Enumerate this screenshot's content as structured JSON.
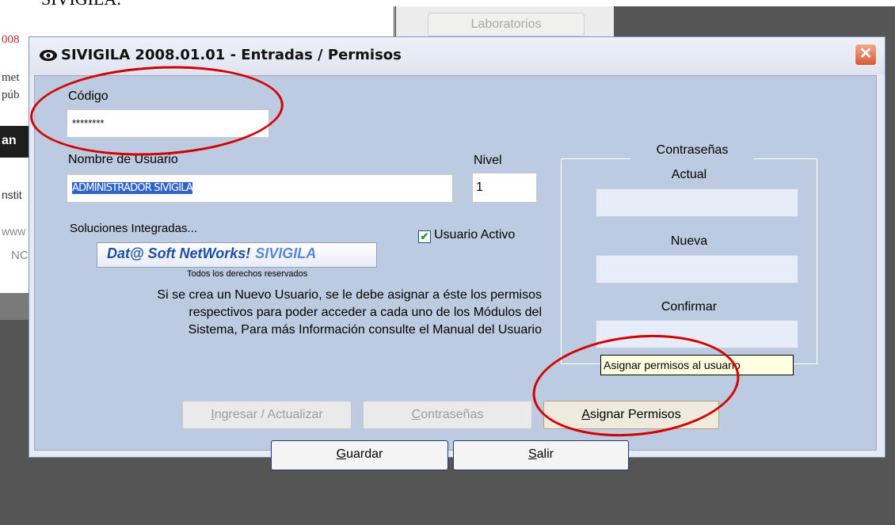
{
  "background": {
    "doc_heading": "SIVIGILA.",
    "lab_button": "Laboratorios",
    "left_fragments": [
      "008",
      "met",
      "púb",
      "an",
      "nstit",
      "www",
      "NC"
    ]
  },
  "window": {
    "title": "SIVIGILA 2008.01.01 - Entradas / Permisos",
    "close_glyph": "✕"
  },
  "form": {
    "codigo_label": "Código",
    "codigo_value": "********",
    "usuario_label": "Nombre de Usuario",
    "usuario_value": "ADMINISTRADOR SIVIGILA",
    "nivel_label": "Nivel",
    "nivel_value": "1",
    "activo_label": "Usuario Activo",
    "activo_checked": true
  },
  "branding": {
    "caption": "Soluciones Integradas...",
    "logo_main": "Dat@ Soft NetWorks!",
    "logo_product": "SIVIGILA",
    "rights": "Todos los derechos reservados"
  },
  "info_lines": [
    "Si se crea un Nuevo Usuario, se le debe asignar a éste los permisos",
    "respectivos para poder acceder a cada uno de los Módulos del",
    "Sistema, Para más Información consulte el Manual del Usuario"
  ],
  "passwords": {
    "group_title": "Contraseñas",
    "actual_label": "Actual",
    "nueva_label": "Nueva",
    "confirmar_label": "Confirmar"
  },
  "buttons": {
    "ingresar": "Ingresar / Actualizar",
    "contrasenas": "Contraseñas",
    "asignar": "Asignar Permisos",
    "guardar": "Guardar",
    "salir": "Salir"
  },
  "tooltip": "Asignar permisos al usuario",
  "colors": {
    "dialog_body": "#bccbe0",
    "annotation_red": "#d20000",
    "tooltip_bg": "#ffffe1"
  }
}
